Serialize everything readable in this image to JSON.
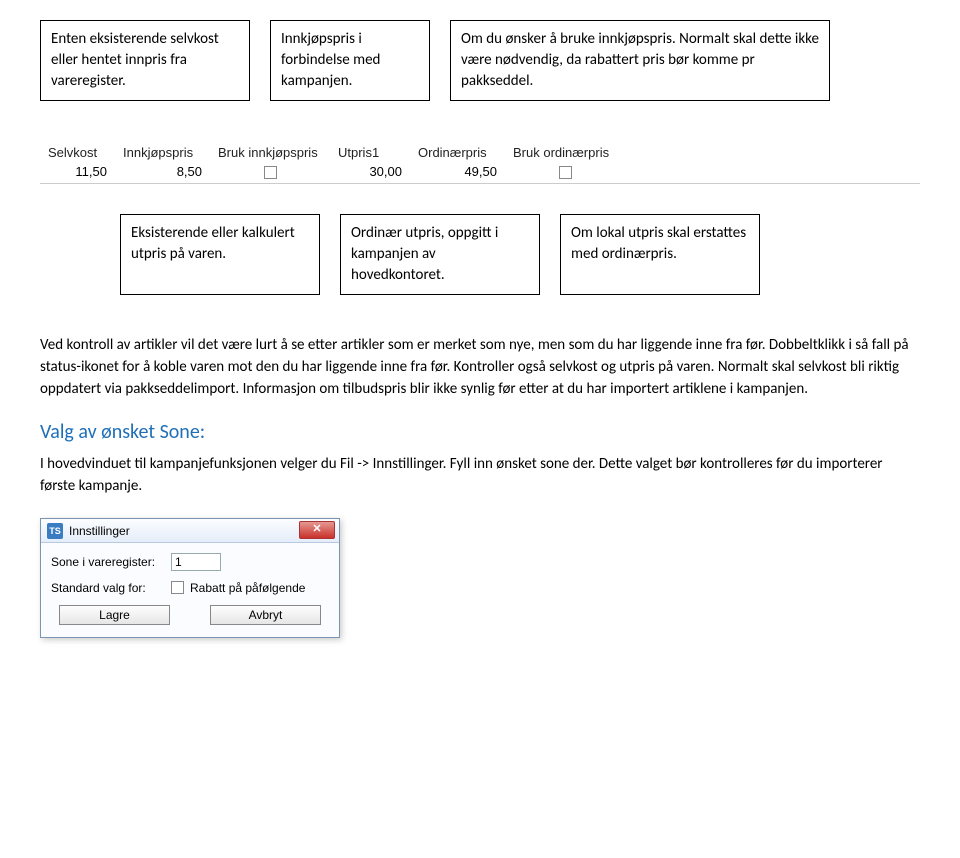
{
  "topBoxes": {
    "b1": "Enten eksisterende selvkost eller hentet innpris fra vareregister.",
    "b2": "Innkjøpspris i forbindelse med kampanjen.",
    "b3": "Om du ønsker å bruke innkjøpspris. Normalt skal dette ikke være nødvendig, da rabattert pris bør komme pr pakkseddel."
  },
  "table": {
    "headers": {
      "selvkost": "Selvkost",
      "innpris": "Innkjøpspris",
      "brukInn": "Bruk innkjøpspris",
      "utpris1": "Utpris1",
      "ordpris": "Ordinærpris",
      "brukOrd": "Bruk ordinærpris"
    },
    "values": {
      "selvkost": "11,50",
      "innpris": "8,50",
      "utpris1": "30,00",
      "ordpris": "49,50"
    }
  },
  "midBoxes": {
    "m1": "Eksisterende eller kalkulert utpris på varen.",
    "m2": "Ordinær utpris, oppgitt i kampanjen av hovedkontoret.",
    "m3": "Om lokal utpris skal erstattes med ordinærpris."
  },
  "para1": "Ved kontroll av artikler vil det være lurt å se etter artikler som er merket som nye, men som du har liggende inne fra før. Dobbeltklikk i så fall på status-ikonet for å koble varen mot den du har liggende inne fra før. Kontroller også selvkost og utpris på varen. Normalt skal selvkost bli riktig oppdatert via pakkseddelimport. Informasjon om tilbudspris blir ikke synlig før etter at du har importert artiklene i kampanjen.",
  "sectionHead": "Valg av ønsket Sone:",
  "para2": "I hovedvinduet til kampanjefunksjonen velger du Fil -> Innstillinger. Fyll inn ønsket sone der. Dette valget bør kontrolleres før du importerer første kampanje.",
  "dialog": {
    "iconText": "TS",
    "title": "Innstillinger",
    "closeGlyph": "✕",
    "fields": {
      "soneLabel": "Sone i vareregister:",
      "soneValue": "1",
      "stdLabel": "Standard valg for:",
      "rabattLabel": "Rabatt på påfølgende"
    },
    "buttons": {
      "save": "Lagre",
      "cancel": "Avbryt"
    }
  }
}
